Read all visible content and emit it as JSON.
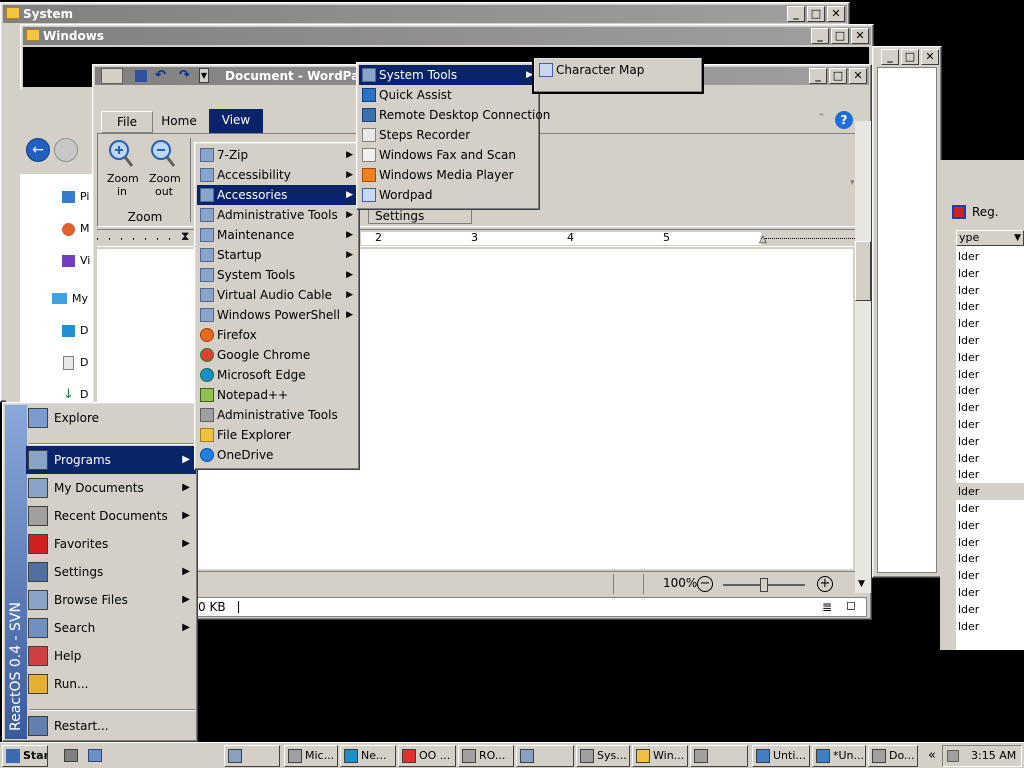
{
  "windows": {
    "system": {
      "title": "System"
    },
    "windows_folder": {
      "title": "Windows"
    },
    "wordpad": {
      "title": "Document - WordPad",
      "tabs": [
        "File",
        "Home",
        "View"
      ],
      "zoom_in": "Zoom in",
      "zoom_out": "Zoom out",
      "zoom_group": "Zoom",
      "settings_group": "Settings",
      "ruler_numbers": [
        "2",
        "3",
        "4",
        "5"
      ],
      "zoom_level": "100%",
      "zoom_level_value": 1.0,
      "status_size": "0 KB"
    }
  },
  "explorer_behind": {
    "nav_items": [
      "Pi",
      "M",
      "Vi",
      "My",
      "D",
      "D",
      "D"
    ]
  },
  "right_panel": {
    "reg_label": "Reg.",
    "column_header": "ype",
    "row_text": "lder",
    "row_count": 23
  },
  "start_menu": {
    "banner": "ReactOS  0.4 - SVN",
    "items": [
      {
        "label": "Explore",
        "arrow": false
      },
      {
        "label": "Programs",
        "arrow": true
      },
      {
        "label": "My Documents",
        "arrow": true
      },
      {
        "label": "Recent Documents",
        "arrow": true
      },
      {
        "label": "Favorites",
        "arrow": true
      },
      {
        "label": "Settings",
        "arrow": true
      },
      {
        "label": "Browse Files",
        "arrow": true
      },
      {
        "label": "Search",
        "arrow": true
      },
      {
        "label": "Help",
        "arrow": false
      },
      {
        "label": "Run...",
        "arrow": false
      },
      {
        "label": "Restart...",
        "arrow": false
      }
    ]
  },
  "programs_menu": {
    "items": [
      {
        "label": "7-Zip",
        "arrow": true
      },
      {
        "label": "Accessibility",
        "arrow": true
      },
      {
        "label": "Accessories",
        "arrow": true
      },
      {
        "label": "Administrative Tools",
        "arrow": true
      },
      {
        "label": "Maintenance",
        "arrow": true
      },
      {
        "label": "Startup",
        "arrow": true
      },
      {
        "label": "System Tools",
        "arrow": true
      },
      {
        "label": "Virtual Audio Cable",
        "arrow": true
      },
      {
        "label": "Windows PowerShell",
        "arrow": true
      },
      {
        "label": "Firefox",
        "arrow": false
      },
      {
        "label": "Google Chrome",
        "arrow": false
      },
      {
        "label": "Microsoft Edge",
        "arrow": false
      },
      {
        "label": "Notepad++",
        "arrow": false
      },
      {
        "label": "Administrative Tools",
        "arrow": false
      },
      {
        "label": "File Explorer",
        "arrow": false
      },
      {
        "label": "OneDrive",
        "arrow": false
      }
    ]
  },
  "accessories_menu": {
    "items": [
      {
        "label": "System Tools",
        "arrow": true
      },
      {
        "label": "Quick Assist",
        "arrow": false
      },
      {
        "label": "Remote Desktop Connection",
        "arrow": false
      },
      {
        "label": "Steps Recorder",
        "arrow": false
      },
      {
        "label": "Windows Fax and Scan",
        "arrow": false
      },
      {
        "label": "Windows Media Player",
        "arrow": false
      },
      {
        "label": "Wordpad",
        "arrow": false
      }
    ]
  },
  "system_tools_menu": {
    "items": [
      {
        "label": "Character Map"
      }
    ]
  },
  "taskbar": {
    "start_label": "Start",
    "buttons": [
      "",
      "Mic...",
      "Ne...",
      "OO ...",
      "RO...",
      "",
      "Sys...",
      "Win...",
      "",
      "Unti...",
      "*Un...",
      "Do..."
    ],
    "clock": "3:15 AM"
  },
  "colors": {
    "selection": "#0a246a",
    "face": "#d4d0c8",
    "desktop": "#000000"
  }
}
